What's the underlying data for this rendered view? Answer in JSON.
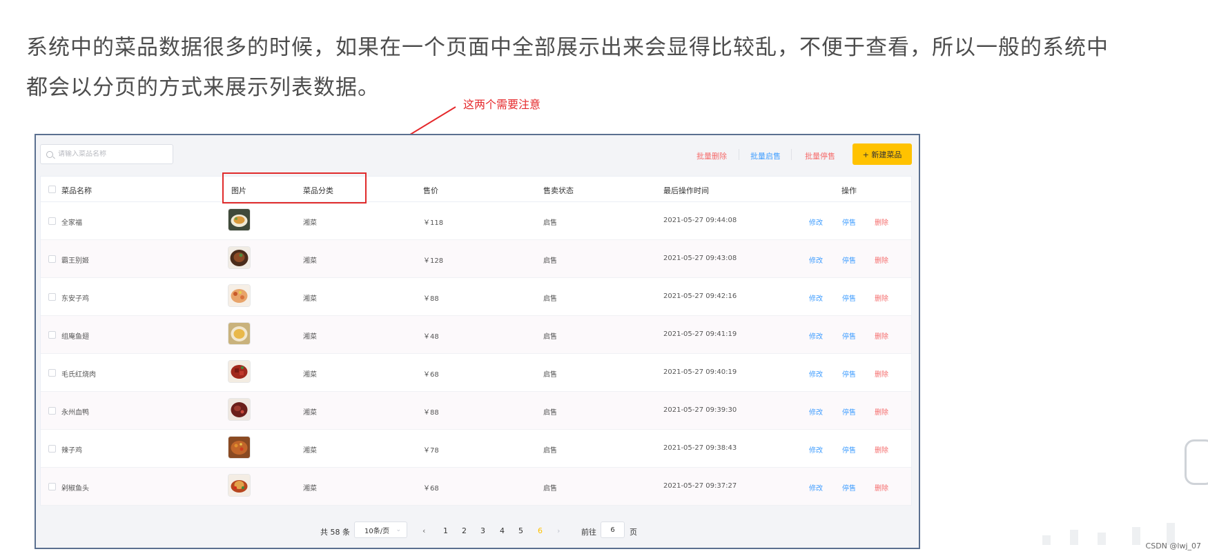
{
  "article": {
    "line1": "系统中的菜品数据很多的时候，如果在一个页面中全部展示出来会显得比较乱，不便于查看，所以一般的系统中",
    "line2": "都会以分页的方式来展示列表数据。"
  },
  "annotation": {
    "text": "这两个需要注意",
    "color": "#e5282b"
  },
  "search": {
    "placeholder": "请输入菜品名称"
  },
  "toolbar": {
    "batch_delete": "批量删除",
    "batch_enable": "批量启售",
    "batch_disable": "批量停售",
    "new_dish": "+ 新建菜品",
    "accent": "#ffc200"
  },
  "table": {
    "headers": {
      "name": "菜品名称",
      "image": "图片",
      "category": "菜品分类",
      "price": "售价",
      "status": "售卖状态",
      "updated": "最后操作时间",
      "actions": "操作"
    },
    "action_labels": {
      "edit": "修改",
      "disable": "停售",
      "delete": "删除"
    },
    "rows": [
      {
        "name": "全家福",
        "image": "dish-photo-1",
        "category": "湘菜",
        "price": "￥118",
        "status": "启售",
        "updated": "2021-05-27 09:44:08"
      },
      {
        "name": "霸王别姬",
        "image": "dish-photo-2",
        "category": "湘菜",
        "price": "￥128",
        "status": "启售",
        "updated": "2021-05-27 09:43:08"
      },
      {
        "name": "东安子鸡",
        "image": "dish-photo-3",
        "category": "湘菜",
        "price": "￥88",
        "status": "启售",
        "updated": "2021-05-27 09:42:16"
      },
      {
        "name": "组庵鱼翅",
        "image": "dish-photo-4",
        "category": "湘菜",
        "price": "￥48",
        "status": "启售",
        "updated": "2021-05-27 09:41:19"
      },
      {
        "name": "毛氏红烧肉",
        "image": "dish-photo-5",
        "category": "湘菜",
        "price": "￥68",
        "status": "启售",
        "updated": "2021-05-27 09:40:19"
      },
      {
        "name": "永州血鸭",
        "image": "dish-photo-6",
        "category": "湘菜",
        "price": "￥88",
        "status": "启售",
        "updated": "2021-05-27 09:39:30"
      },
      {
        "name": "辣子鸡",
        "image": "dish-photo-7",
        "category": "湘菜",
        "price": "￥78",
        "status": "启售",
        "updated": "2021-05-27 09:38:43"
      },
      {
        "name": "剁椒鱼头",
        "image": "dish-photo-8",
        "category": "湘菜",
        "price": "￥68",
        "status": "启售",
        "updated": "2021-05-27 09:37:27"
      }
    ]
  },
  "pagination": {
    "total": "共 58 条",
    "page_size": "10条/页",
    "pages": [
      "1",
      "2",
      "3",
      "4",
      "5",
      "6"
    ],
    "current_page": "6",
    "goto_label": "前往",
    "goto_value": "6",
    "goto_suffix": "页"
  },
  "colors": {
    "link_blue": "#419eff",
    "link_red": "#f56c6c",
    "highlight": "#e02a2a",
    "current_page": "#ffc200"
  },
  "watermark": "CSDN @lwj_07"
}
